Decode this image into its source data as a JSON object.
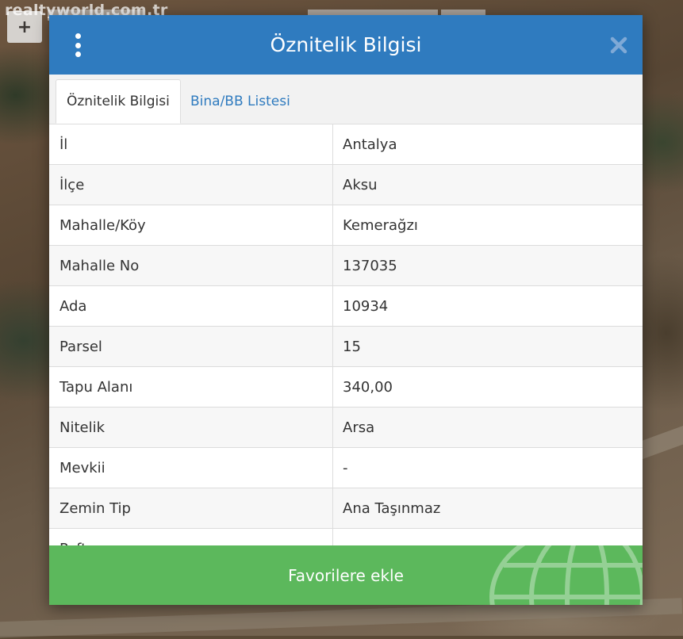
{
  "watermark": "realtyworld.com.tr",
  "map": {
    "zoom_in_label": "+"
  },
  "modal": {
    "title": "Öznitelik Bilgisi",
    "close_symbol": "✕",
    "tabs": [
      {
        "label": "Öznitelik Bilgisi",
        "active": true
      },
      {
        "label": "Bina/BB Listesi",
        "active": false
      }
    ],
    "rows": [
      {
        "label": "İl",
        "value": "Antalya"
      },
      {
        "label": "İlçe",
        "value": "Aksu"
      },
      {
        "label": "Mahalle/Köy",
        "value": "Kemerağzı"
      },
      {
        "label": "Mahalle No",
        "value": "137035"
      },
      {
        "label": "Ada",
        "value": "10934"
      },
      {
        "label": "Parsel",
        "value": "15"
      },
      {
        "label": "Tapu Alanı",
        "value": "340,00"
      },
      {
        "label": "Nitelik",
        "value": "Arsa"
      },
      {
        "label": "Mevkii",
        "value": "-"
      },
      {
        "label": "Zemin Tip",
        "value": "Ana Taşınmaz"
      },
      {
        "label": "Pafta",
        "value": ""
      }
    ],
    "footer_button": "Favorilere ekle"
  },
  "colors": {
    "header": "#2f7bbf",
    "tab_link": "#2f7bbf",
    "footer_button": "#5cb85c"
  },
  "icons": {
    "menu": "vertical-dots-icon",
    "close": "close-icon",
    "zoom": "plus-icon"
  }
}
